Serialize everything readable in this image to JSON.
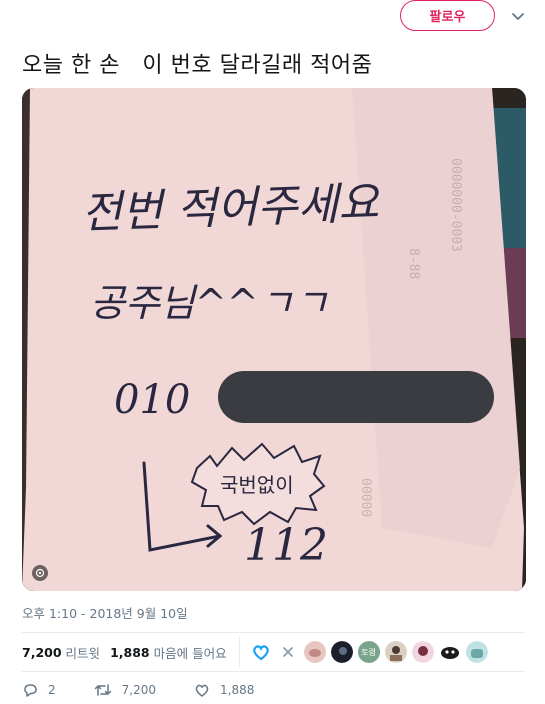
{
  "header": {
    "follow_label": "팔로우"
  },
  "tweet": {
    "text": "오늘 한 손   이 번호 달라길래 적어줌",
    "timestamp": "오후 1:10 - 2018년 9월 10일"
  },
  "photo": {
    "handwriting": {
      "line1": "전번 적어주세요",
      "line2": "공주님^^ㄱㄱ",
      "line3": "010",
      "burst": "국번없이",
      "number": "112"
    }
  },
  "stats": {
    "retweets_count": "7,200",
    "retweets_label": "리트윗",
    "likes_count": "1,888",
    "likes_label": "마음에 들어요",
    "liker_badge": "토령"
  },
  "actions": {
    "reply_count": "2",
    "retweet_count": "7,200",
    "like_count": "1,888"
  },
  "colors": {
    "accent": "#e0245e",
    "muted": "#657786",
    "link": "#1da1f2"
  },
  "icons": [
    "chevron-down-icon",
    "gif-icon",
    "heart-icon",
    "close-icon",
    "reply-icon",
    "retweet-icon",
    "like-icon"
  ]
}
